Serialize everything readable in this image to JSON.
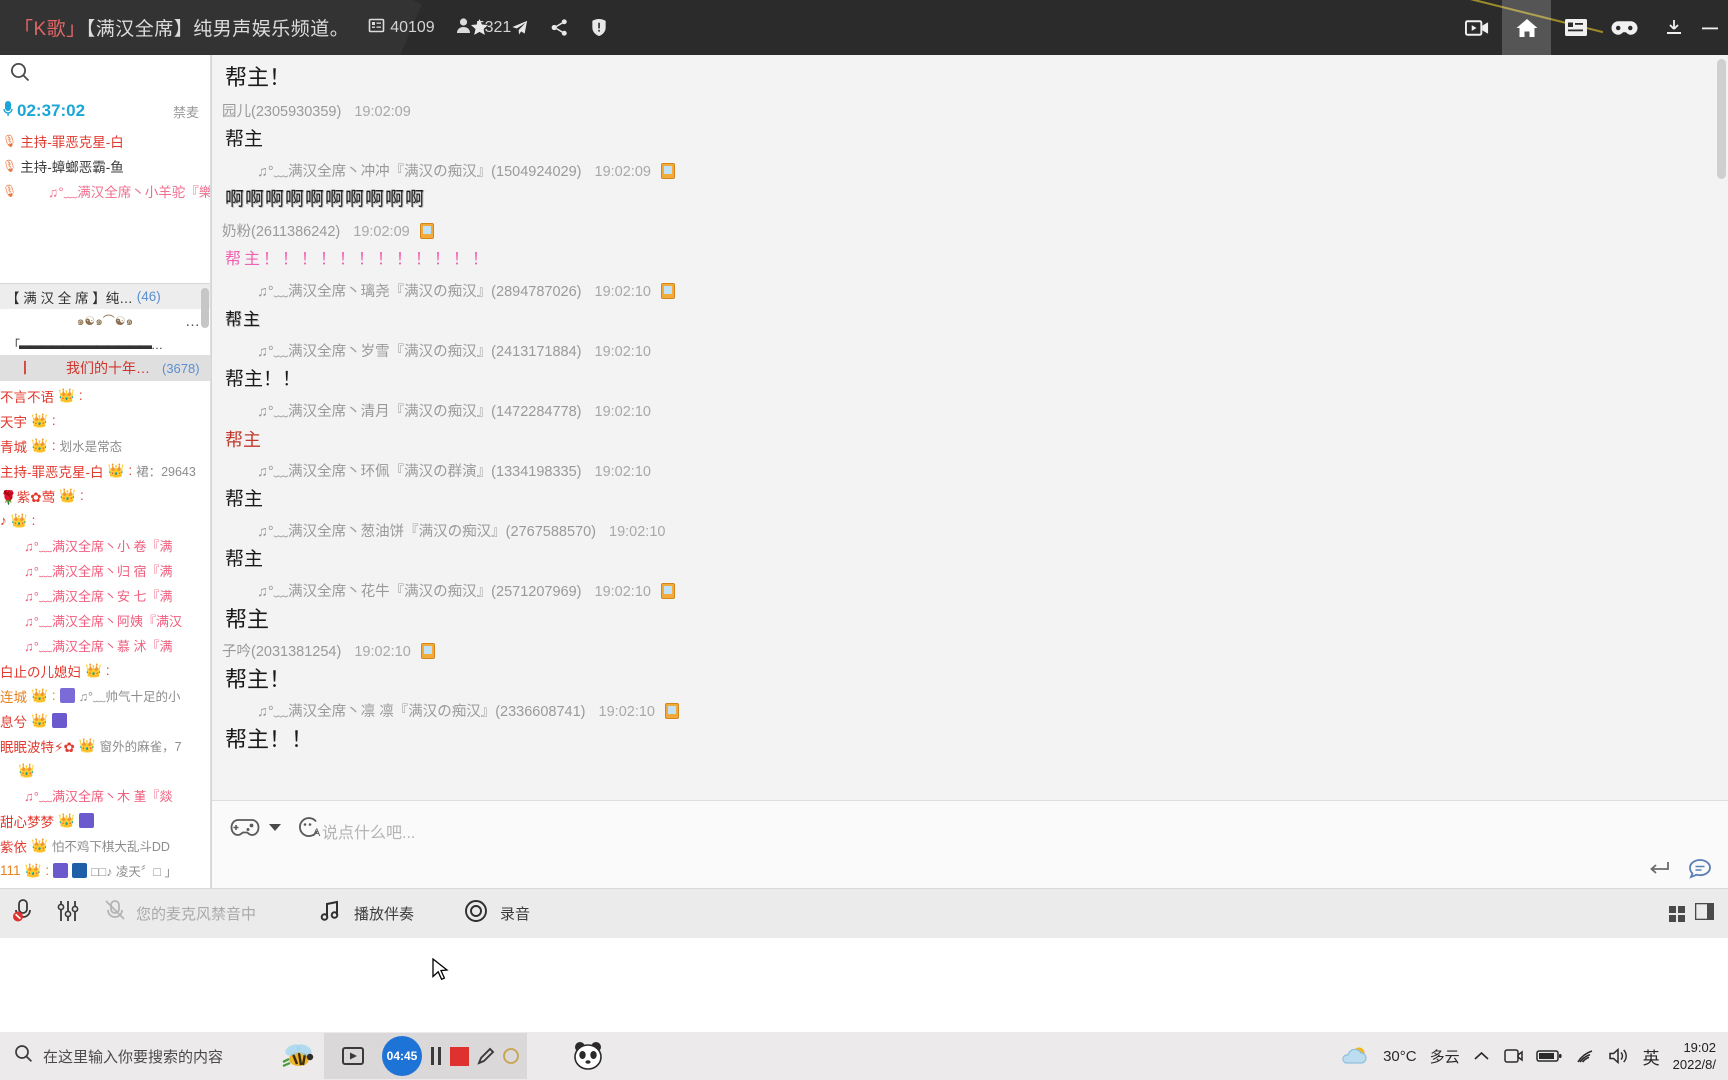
{
  "titlebar": {
    "room_prefix": "「K歌」",
    "room_name": "【满汉全席】纯男声娱乐频道。",
    "room_id_label": "40109",
    "user_count_label": "5321",
    "icons": [
      "id-card-icon",
      "person-icon",
      "star-icon",
      "airplane-icon",
      "share-icon",
      "info-icon"
    ],
    "right_icons": [
      "video-record-icon",
      "home-icon",
      "news-list-icon",
      "gamepad-icon",
      "minimize-down-icon",
      "minimize-icon"
    ],
    "active_right_icon": "home-icon"
  },
  "sidebar": {
    "search_placeholder": "",
    "mic_timer": "02:37:02",
    "mute_label": "禁麦",
    "hosts": [
      {
        "name": "主持-罪恶克星-白",
        "style": "red"
      },
      {
        "name": "主持-蟑螂恶霸-鱼",
        "style": "dark"
      },
      {
        "name": "♫°﹏满汉全席丶小羊驼『樂",
        "style": "pink"
      }
    ],
    "room_header": {
      "title": "【 满 汉 全 席 】纯…",
      "count": "(46)",
      "decor": "๑☯๑⌒☯๑",
      "more": "…",
      "dashes": "「▬▬▬▬▬▬▬▬▬▬▬▬…"
    },
    "song_header": {
      "bar": "丨",
      "title": "我们的十年…",
      "count": "(3678)"
    },
    "users": [
      {
        "name": "不言不语",
        "style": "red",
        "badges": [
          "crown"
        ],
        "msg": ""
      },
      {
        "name": "天宇",
        "style": "red",
        "badges": [
          "crown"
        ],
        "msg": ""
      },
      {
        "name": "青城",
        "style": "red",
        "badges": [
          "crown"
        ],
        "msg": "划水是常态"
      },
      {
        "name": "主持-罪恶克星-白",
        "style": "red",
        "badges": [
          "crown"
        ],
        "msg": "裙：29643"
      },
      {
        "name": "🌹紫✿莺",
        "style": "red",
        "badges": [
          "crown"
        ],
        "msg": ""
      },
      {
        "name": "♪",
        "style": "red",
        "badges": [
          "crown"
        ],
        "msg": ""
      },
      {
        "name": "♫°﹏满汉全席丶小  卷『满",
        "style": "song",
        "badges": [],
        "msg": ""
      },
      {
        "name": "♫°﹏满汉全席丶归  宿『满",
        "style": "song",
        "badges": [],
        "msg": ""
      },
      {
        "name": "♫°﹏满汉全席丶安  七『满",
        "style": "song",
        "badges": [],
        "msg": ""
      },
      {
        "name": "♫°﹏满汉全席丶阿姨『满汉",
        "style": "song",
        "badges": [],
        "msg": ""
      },
      {
        "name": "♫°﹏满汉全席丶慕  沭『满",
        "style": "song",
        "badges": [],
        "msg": ""
      },
      {
        "name": "白止の儿媳妇",
        "style": "red",
        "badges": [
          "crown"
        ],
        "msg": ""
      },
      {
        "name": "连城",
        "style": "orange",
        "badges": [
          "crown",
          "s-badge"
        ],
        "msg": "♫°﹏帅气十足的小"
      },
      {
        "name": "息兮",
        "style": "red",
        "badges": [
          "crown",
          "jue-badge"
        ],
        "msg": ""
      },
      {
        "name": "眠眠波特⚡✿",
        "style": "red",
        "badges": [
          "crown"
        ],
        "msg": "窗外的麻雀，7"
      },
      {
        "name": "",
        "style": "red",
        "badges": [
          "crown"
        ],
        "msg": ""
      },
      {
        "name": "♫°﹏满汉全席丶木  堇『燚",
        "style": "song",
        "badges": [],
        "msg": ""
      },
      {
        "name": "甜心梦梦",
        "style": "red",
        "badges": [
          "crown",
          "jue-badge"
        ],
        "msg": ""
      },
      {
        "name": "紫依",
        "style": "red",
        "badges": [
          "crown"
        ],
        "msg": "怕不鸡下棋大乱斗DD"
      },
      {
        "name": "111",
        "style": "orange",
        "badges": [
          "gold-crown",
          "jue-badge",
          "eye-badge"
        ],
        "msg": "□□♪ 凌天〞□ 」"
      }
    ]
  },
  "chat": {
    "top_message": "帮主！",
    "messages": [
      {
        "name": "园儿(2305930359)",
        "time": "19:02:09",
        "phone": false,
        "indent": false,
        "text": "帮主",
        "style": "plain",
        "size": "normal"
      },
      {
        "name": "♫°﹏满汉全席丶冲冲『满汉の痴汉』(1504924029)",
        "time": "19:02:09",
        "phone": true,
        "indent": true,
        "text": "啊啊啊啊啊啊啊啊啊啊",
        "style": "shadow",
        "size": "normal"
      },
      {
        "name": "奶粉(2611386242)",
        "time": "19:02:09",
        "phone": true,
        "indent": false,
        "text": "帮主！！！！！！！！！！！！",
        "style": "pink",
        "size": "small"
      },
      {
        "name": "♫°﹏满汉全席丶璃尧『满汉の痴汉』(2894787026)",
        "time": "19:02:10",
        "phone": true,
        "indent": true,
        "text": "帮主",
        "style": "shadow",
        "size": "small"
      },
      {
        "name": "♫°﹏满汉全席丶岁雪『满汉の痴汉』(2413171884)",
        "time": "19:02:10",
        "phone": false,
        "indent": true,
        "text": "帮主！！",
        "style": "plain",
        "size": "normal"
      },
      {
        "name": "♫°﹏满汉全席丶清月『满汉の痴汉』(1472284778)",
        "time": "19:02:10",
        "phone": false,
        "indent": true,
        "text": "帮主",
        "style": "red",
        "size": "normal"
      },
      {
        "name": "♫°﹏满汉全席丶环佩『满汉の群演』(1334198335)",
        "time": "19:02:10",
        "phone": false,
        "indent": true,
        "text": "帮主",
        "style": "plain",
        "size": "normal"
      },
      {
        "name": "♫°﹏满汉全席丶葱油饼『满汉の痴汉』(2767588570)",
        "time": "19:02:10",
        "phone": false,
        "indent": true,
        "text": "帮主",
        "style": "plain",
        "size": "normal"
      },
      {
        "name": "♫°﹏满汉全席丶花牛『满汉の痴汉』(2571207969)",
        "time": "19:02:10",
        "phone": true,
        "indent": true,
        "text": "帮主",
        "style": "plain",
        "size": "big"
      },
      {
        "name": "子吟(2031381254)",
        "time": "19:02:10",
        "phone": true,
        "indent": false,
        "text": "帮主！",
        "style": "plain",
        "size": "big"
      },
      {
        "name": "♫°﹏满汉全席丶凛  凛『满汉の痴汉』(2336608741)",
        "time": "19:02:10",
        "phone": true,
        "indent": true,
        "text": "帮主！！",
        "style": "plain",
        "size": "big"
      }
    ]
  },
  "composer": {
    "gamepad_icon": "gamepad-icon",
    "emoji_icon": "emoji-text-icon",
    "placeholder": "说点什么吧...",
    "send_icon": "enter-send-icon",
    "chat_icon": "speech-bubble-icon"
  },
  "statusbar": {
    "mic_muted_icon": "mic-muted-icon",
    "mixer_icon": "audio-mixer-icon",
    "mute_note_icon": "mic-off-small-icon",
    "mute_note": "您的麦克风禁音中",
    "accompany_icon": "music-note-icon",
    "accompany_label": "播放伴奏",
    "record_icon": "record-circle-icon",
    "record_label": "录音",
    "grid_icon": "grid-icon",
    "panel_icon": "panel-icon"
  },
  "taskbar": {
    "search_placeholder": "在这里输入你要搜索的内容",
    "search_icon": "search-icon",
    "apps": [
      "bee-app-icon",
      "media-app-icon",
      "panda-app-icon"
    ],
    "timer_value": "04:45",
    "controls": [
      "pause-icon",
      "stop-icon",
      "pen-icon",
      "circle-icon"
    ],
    "tray": {
      "weather_icon": "partly-cloudy-icon",
      "temperature": "30°C",
      "weather_label": "多云",
      "chevron_icon": "chevron-up-icon",
      "icons": [
        "camera-icon",
        "battery-icon",
        "wifi-icon",
        "volume-icon"
      ],
      "ime_label": "英",
      "time": "19:02",
      "date": "2022/8/"
    }
  },
  "colors": {
    "titlebar_bg": "#2b2b2b",
    "accent_blue": "#1ba7d6",
    "name_red": "#e23a2e",
    "song_pink": "#ef5f7f",
    "pink_msg": "#f062b0",
    "chat_bg": "#f3f3f3"
  }
}
